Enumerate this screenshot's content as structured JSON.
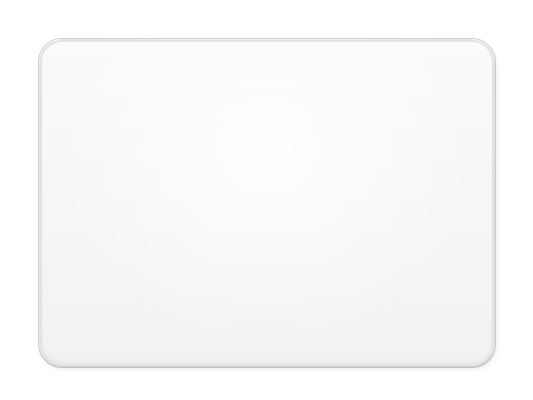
{
  "image": {
    "subject": "trackpad-icon",
    "colors": {
      "background": "#ffffff",
      "surface": "#f6f6f6",
      "edge": "#d9d9d9"
    }
  }
}
